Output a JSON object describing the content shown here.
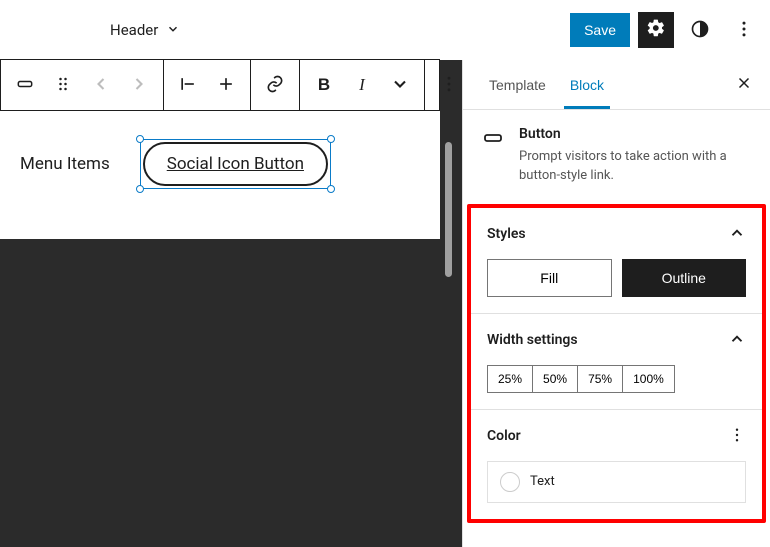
{
  "topbar": {
    "doc_title": "Header",
    "save_label": "Save"
  },
  "canvas": {
    "menu_label": "Menu Items",
    "button_text": "Social Icon Button"
  },
  "sidebar": {
    "tabs": {
      "template": "Template",
      "block": "Block"
    },
    "block_info": {
      "title": "Button",
      "desc": "Prompt visitors to take action with a button-style link."
    },
    "panels": {
      "styles": {
        "title": "Styles",
        "fill": "Fill",
        "outline": "Outline"
      },
      "width": {
        "title": "Width settings",
        "options": [
          "25%",
          "50%",
          "75%",
          "100%"
        ]
      },
      "color": {
        "title": "Color",
        "text_label": "Text"
      }
    }
  }
}
